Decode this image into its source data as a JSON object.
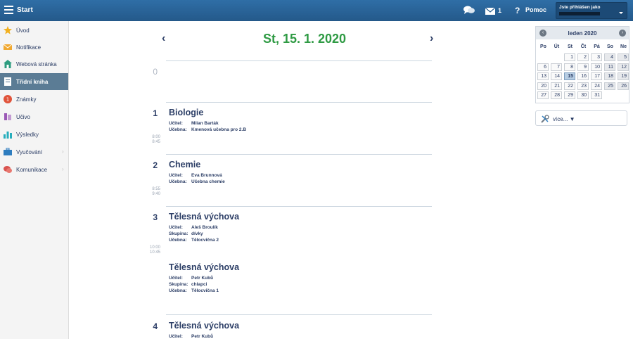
{
  "topbar": {
    "start_label": "Start",
    "mail_count": "1",
    "help_label": "Pomoc",
    "user_label": "Jste přihlášen jako"
  },
  "sidebar": {
    "items": [
      {
        "label": "Úvod",
        "icon": "star-icon"
      },
      {
        "label": "Notifikace",
        "icon": "envelope-icon"
      },
      {
        "label": "Webová stránka",
        "icon": "home-icon"
      },
      {
        "label": "Třídní kniha",
        "icon": "book-icon",
        "active": true
      },
      {
        "label": "Známky",
        "icon": "grade-icon"
      },
      {
        "label": "Učivo",
        "icon": "books-icon"
      },
      {
        "label": "Výsledky",
        "icon": "bar-chart-icon"
      },
      {
        "label": "Vyučování",
        "icon": "briefcase-icon",
        "has_submenu": true
      },
      {
        "label": "Komunikace",
        "icon": "chat-icon",
        "has_submenu": true
      }
    ]
  },
  "main": {
    "date_title": "St, 15. 1. 2020",
    "lessons": [
      {
        "num": "0"
      },
      {
        "num": "1",
        "time_start": "8:00",
        "time_end": "8:45",
        "blocks": [
          {
            "subject": "Biologie",
            "details": [
              {
                "k": "Učitel:",
                "v": "Milan Barták"
              },
              {
                "k": "Učebna:",
                "v": "Kmenová učebna pro 2.B"
              }
            ]
          }
        ]
      },
      {
        "num": "2",
        "time_start": "8:55",
        "time_end": "9:40",
        "blocks": [
          {
            "subject": "Chemie",
            "details": [
              {
                "k": "Učitel:",
                "v": "Eva Brunnová"
              },
              {
                "k": "Učebna:",
                "v": "Učebna chemie"
              }
            ]
          }
        ]
      },
      {
        "num": "3",
        "time_start": "10:00",
        "time_end": "10:45",
        "blocks": [
          {
            "subject": "Tělesná výchova",
            "details": [
              {
                "k": "Učitel:",
                "v": "Aleš Broulík"
              },
              {
                "k": "Skupina:",
                "v": "dívky"
              },
              {
                "k": "Učebna:",
                "v": "Tělocvična 2"
              }
            ]
          },
          {
            "subject": "Tělesná výchova",
            "details": [
              {
                "k": "Učitel:",
                "v": "Petr Kubů"
              },
              {
                "k": "Skupina:",
                "v": "chlapci"
              },
              {
                "k": "Učebna:",
                "v": "Tělocvična 1"
              }
            ]
          }
        ]
      },
      {
        "num": "4",
        "blocks": [
          {
            "subject": "Tělesná výchova",
            "details": [
              {
                "k": "Učitel:",
                "v": "Petr Kubů"
              }
            ]
          }
        ]
      }
    ]
  },
  "calendar": {
    "title": "leden 2020",
    "dow": [
      "Po",
      "Út",
      "St",
      "Čt",
      "Pá",
      "So",
      "Ne"
    ],
    "weeks": [
      [
        "",
        "",
        "1",
        "2",
        "3",
        "4",
        "5"
      ],
      [
        "6",
        "7",
        "8",
        "9",
        "10",
        "11",
        "12"
      ],
      [
        "13",
        "14",
        "15",
        "16",
        "17",
        "18",
        "19"
      ],
      [
        "20",
        "21",
        "22",
        "23",
        "24",
        "25",
        "26"
      ],
      [
        "27",
        "28",
        "29",
        "30",
        "31",
        "",
        ""
      ]
    ],
    "today": "15"
  },
  "more": {
    "label": "více...",
    "caret": "▼"
  }
}
